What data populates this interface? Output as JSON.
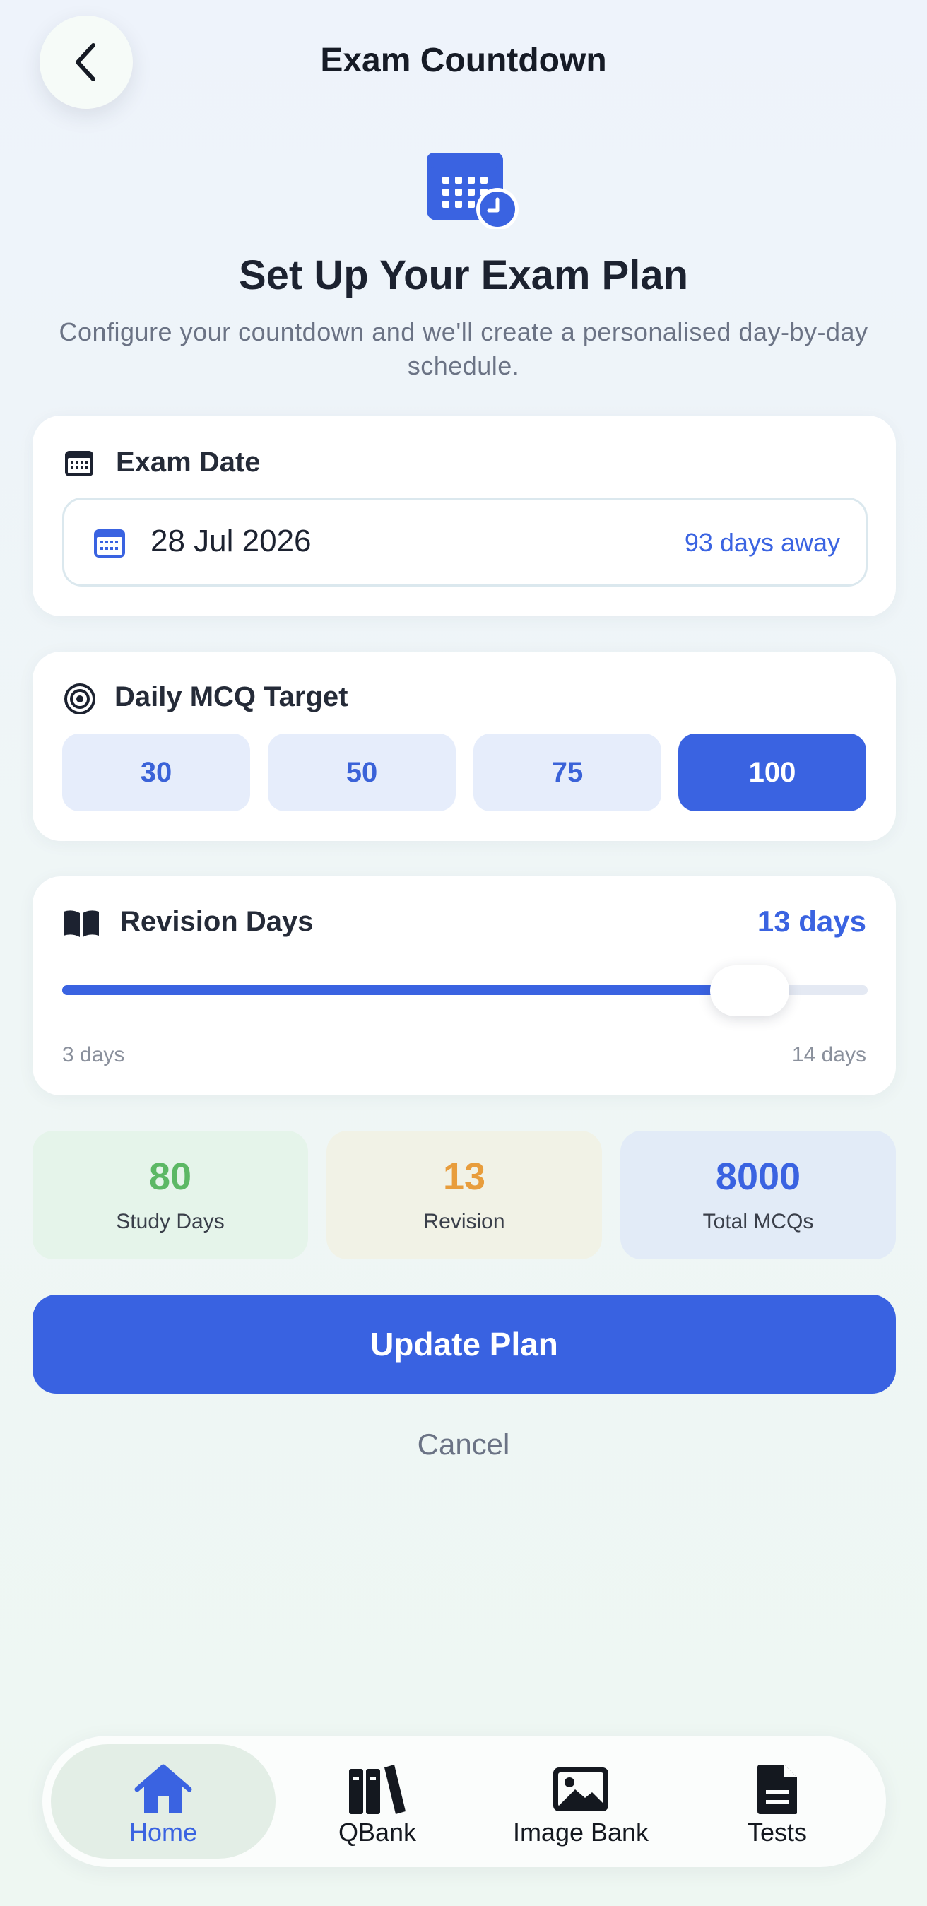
{
  "header": {
    "title": "Exam Countdown",
    "back_icon": "chevron-left-icon"
  },
  "hero": {
    "icon": "calendar-clock-icon",
    "title": "Set Up Your Exam Plan",
    "subtitle": "Configure your countdown and we'll create a personalised day-by-day schedule."
  },
  "exam_date": {
    "label": "Exam Date",
    "value": "28 Jul 2026",
    "days_away": "93 days away"
  },
  "daily_target": {
    "label": "Daily MCQ Target",
    "options": [
      "30",
      "50",
      "75",
      "100"
    ],
    "selected": "100"
  },
  "revision": {
    "label": "Revision Days",
    "value_text": "13 days",
    "value": 13,
    "min": 3,
    "max": 14,
    "min_label": "3 days",
    "max_label": "14 days"
  },
  "stats": [
    {
      "value": "80",
      "label": "Study Days",
      "color": "#5cb865",
      "bg": "#e5f4ea"
    },
    {
      "value": "13",
      "label": "Revision",
      "color": "#e89d3c",
      "bg": "#f1f2e6"
    },
    {
      "value": "8000",
      "label": "Total MCQs",
      "color": "#3a63e1",
      "bg": "#e2ebf7"
    }
  ],
  "actions": {
    "primary": "Update Plan",
    "cancel": "Cancel"
  },
  "tabbar": {
    "items": [
      {
        "label": "Home",
        "icon": "home-icon",
        "active": true
      },
      {
        "label": "QBank",
        "icon": "books-icon",
        "active": false
      },
      {
        "label": "Image Bank",
        "icon": "image-icon",
        "active": false
      },
      {
        "label": "Tests",
        "icon": "document-icon",
        "active": false
      }
    ]
  },
  "colors": {
    "accent": "#3a63e1",
    "background": "#eef4f6"
  }
}
